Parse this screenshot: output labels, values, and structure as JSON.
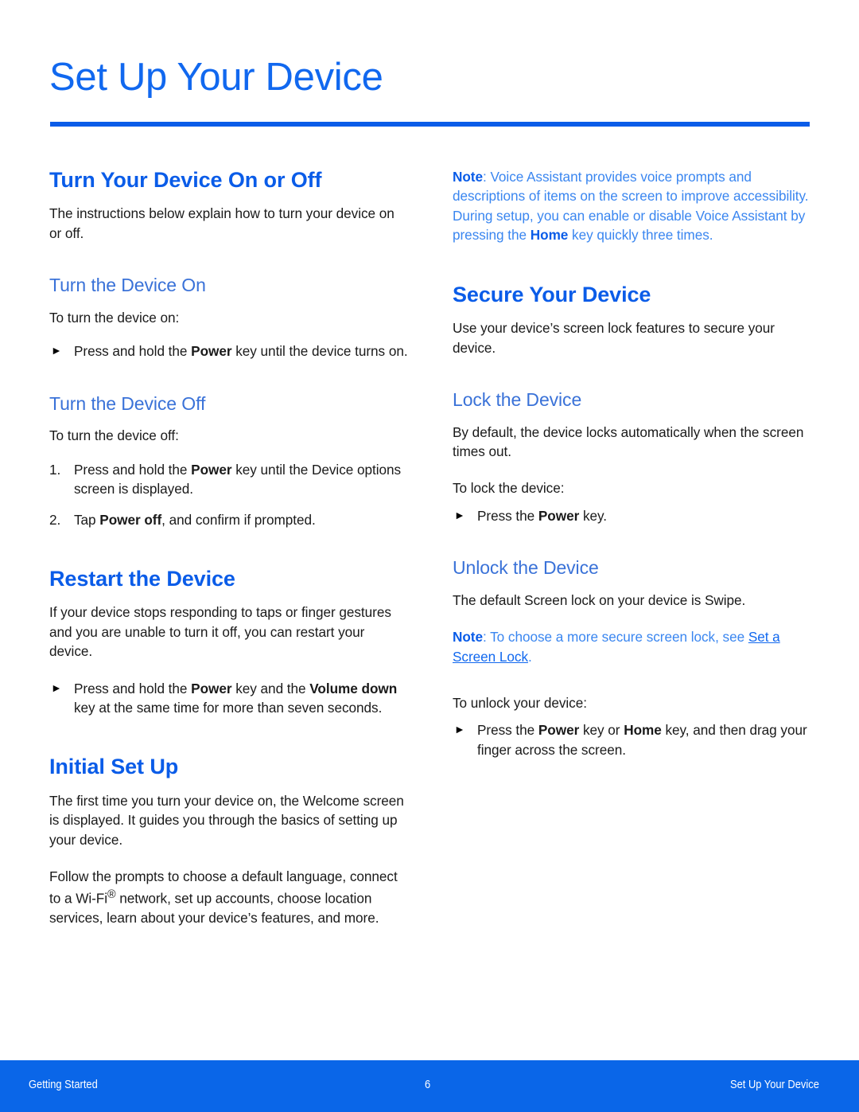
{
  "document": {
    "title": "Set Up Your Device",
    "accent_color": "#0a5ce8",
    "subheading_color": "#3a72d8",
    "note_color": "#3a86f0",
    "body_color": "#1a1a1a"
  },
  "left_column": {
    "section1": {
      "heading": "Turn Your Device On or Off",
      "intro": "The instructions below explain how to turn your device on or off.",
      "sub1": {
        "heading": "Turn the Device On",
        "lead": "To turn the device on:",
        "bullet": {
          "marker": "triangle-right-icon",
          "text_before": "Press and hold the ",
          "bold": "Power",
          "text_after": " key until the device turns on."
        }
      },
      "sub2": {
        "heading": "Turn the Device Off",
        "lead": "To turn the device off:",
        "steps": [
          {
            "number": "1.",
            "text_before": "Press and hold the ",
            "bold": "Power",
            "text_after": " key until the Device options screen is displayed."
          },
          {
            "number": "2.",
            "text_before": "Tap ",
            "bold": "Power off",
            "text_after": ", and confirm if prompted."
          }
        ]
      }
    },
    "section2": {
      "heading": "Restart the Device",
      "intro": "If your device stops responding to taps or finger gestures and you are unable to turn it off, you can restart your device.",
      "bullet": {
        "marker": "triangle-right-icon",
        "text_before": "Press and hold the ",
        "bold1": "Power",
        "text_middle": " key and the ",
        "bold2": "Volume down",
        "text_after": " key at the same time for more than seven seconds."
      }
    },
    "section3": {
      "heading": "Initial Set Up",
      "para1": "The first time you turn your device on, the Welcome screen is displayed. It guides you through the basics of setting up your device.",
      "para2_before": "Follow the prompts to choose a default language, connect to a Wi-Fi",
      "para2_sup": "®",
      "para2_after": " network, set up accounts, choose location services, learn about your device’s features, and more."
    }
  },
  "right_column": {
    "note_top": {
      "label": "Note",
      "text_before": ": Voice Assistant provides voice prompts and descriptions of items on the screen to improve accessibility. During setup, you can enable or disable Voice Assistant by pressing the ",
      "bold": "Home",
      "text_after": " key quickly three times."
    },
    "section1": {
      "heading": "Secure Your Device",
      "intro": "Use your device’s screen lock features to secure your device.",
      "sub1": {
        "heading": "Lock the Device",
        "para": "By default, the device locks automatically when the screen times out.",
        "lead": "To lock the device:",
        "bullet": {
          "marker": "triangle-right-icon",
          "text_before": "Press the ",
          "bold": "Power",
          "text_after": " key."
        }
      },
      "sub2": {
        "heading": "Unlock the Device",
        "para": "The default Screen lock on your device is Swipe.",
        "note": {
          "label": "Note",
          "text_before": ": To choose a more secure screen lock, see ",
          "link": "Set a Screen Lock",
          "text_after": "."
        },
        "lead": "To unlock your device:",
        "bullet": {
          "marker": "triangle-right-icon",
          "text_before": "Press the ",
          "bold1": "Power",
          "text_middle": " key or ",
          "bold2": "Home",
          "text_after": " key, and then drag your finger across the screen."
        }
      }
    }
  },
  "footer": {
    "left": "Getting Started",
    "page_number": "6",
    "right": "Set Up Your Device",
    "background_color": "#0a66e8"
  }
}
